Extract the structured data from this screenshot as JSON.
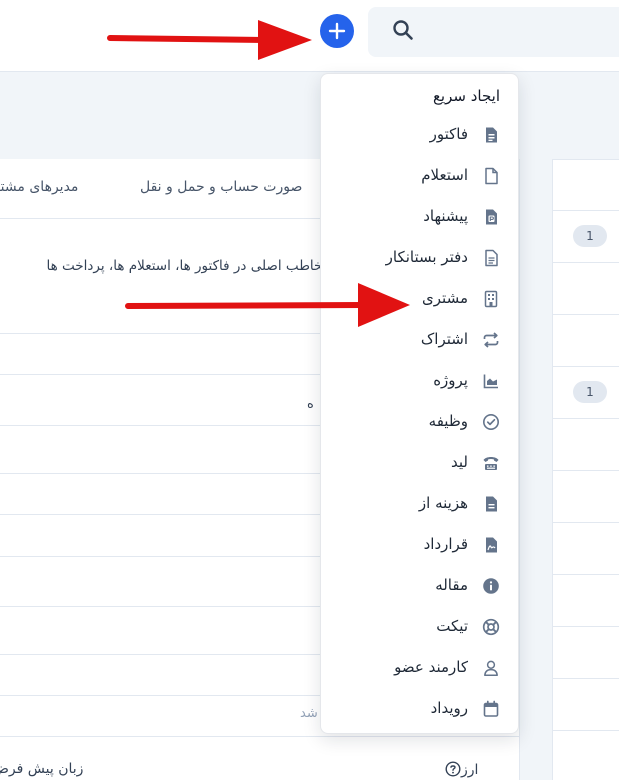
{
  "search": {
    "icon": "search-icon"
  },
  "add_button": {
    "icon": "plus-icon",
    "color": "#2563eb"
  },
  "tabs": [
    {
      "label": "مدیرهای مشتری"
    },
    {
      "label": "صورت حساب و حمل و نقل"
    }
  ],
  "panel": {
    "description": "مخاطب اصلی در فاکتور ها، استعلام ها، پرداخت ها",
    "fragment_1": "ه",
    "fragment_placeholder": "شد",
    "currency_label": "ارز",
    "language_label": "زبان پیش فرض"
  },
  "right_panel": {
    "badges": [
      "1",
      "1"
    ]
  },
  "quick_create": {
    "header": "ایجاد سریع",
    "items": [
      {
        "label": "فاکتور",
        "icon": "invoice-icon"
      },
      {
        "label": "استعلام",
        "icon": "file-icon"
      },
      {
        "label": "پیشنهاد",
        "icon": "proposal-icon"
      },
      {
        "label": "دفتر بستانکار",
        "icon": "credit-note-icon"
      },
      {
        "label": "مشتری",
        "icon": "building-icon"
      },
      {
        "label": "اشتراک",
        "icon": "repeat-icon"
      },
      {
        "label": "پروژه",
        "icon": "chart-area-icon"
      },
      {
        "label": "وظیفه",
        "icon": "check-circle-icon"
      },
      {
        "label": "لید",
        "icon": "tty-icon"
      },
      {
        "label": "هزینه از",
        "icon": "receipt-icon"
      },
      {
        "label": "قرارداد",
        "icon": "contract-icon"
      },
      {
        "label": "مقاله",
        "icon": "info-circle-icon"
      },
      {
        "label": "تیکت",
        "icon": "life-ring-icon"
      },
      {
        "label": "کارمند عضو",
        "icon": "user-icon"
      },
      {
        "label": "رویداد",
        "icon": "calendar-icon"
      }
    ]
  },
  "colors": {
    "accent": "#2563eb",
    "annotation_arrow": "#e11212"
  }
}
